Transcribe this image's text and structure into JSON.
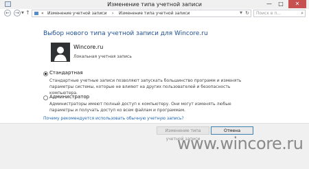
{
  "window": {
    "title": "Изменение типа учетной записи",
    "min_glyph": "—",
    "max_glyph": "□",
    "close_glyph": "✕"
  },
  "nav": {
    "back_glyph": "←",
    "forward_glyph": "→",
    "up_glyph": "↑",
    "breadcrumb_chevron": "«",
    "breadcrumb_sep": "›",
    "breadcrumb": [
      "Изменение учетной записи",
      "Изменение типа учетной записи"
    ],
    "refresh_glyph": "↻",
    "search_placeholder": "Поиск в п...",
    "search_glyph": "⌕"
  },
  "content": {
    "heading": "Выбор нового типа учетной записи для Wincore.ru",
    "user_name": "Wincore.ru",
    "user_type": "Локальная учетная запись",
    "options": [
      {
        "label": "Стандартная",
        "checked": true,
        "description": "Стандартные учетные записи позволяют запускать большинство программ и изменять параметры системы, которые не влияют на других пользователей и безопасность компьютера."
      },
      {
        "label": "Администратор",
        "checked": false,
        "description": "Администраторы имеют полный доступ к компьютеру. Они могут изменять любые параметры и получать доступ ко всем файлам и программам."
      }
    ],
    "help_link": "Почему рекомендуется использовать обычную учетную запись?"
  },
  "footer": {
    "change_button": "Изменение типа учетной записи",
    "cancel_button": "Отмена"
  },
  "watermark": "www.wincore.ru",
  "colors": {
    "heading": "#1e4e96",
    "link": "#1e63b4",
    "close_button": "#c75050",
    "avatar_bg": "#2f3133"
  }
}
